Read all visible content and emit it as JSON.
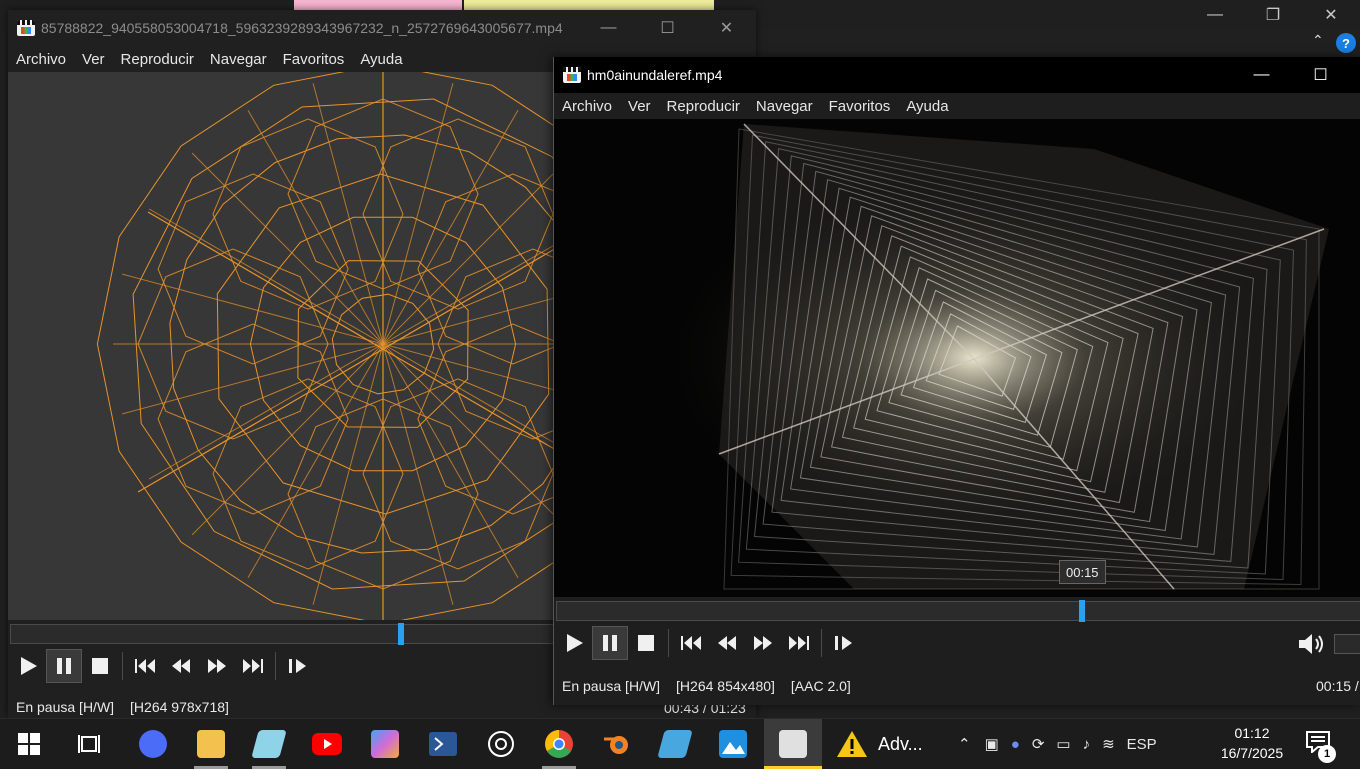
{
  "background_app": {
    "window_controls": [
      "—",
      "❐",
      "✕"
    ],
    "help_glyph": "?",
    "collapse_glyph": "⌃"
  },
  "player1": {
    "title": "85788822_940558053004718_5963239289343967232_n_2572769643005677.mp4",
    "window_controls": {
      "minimize": "—",
      "maximize": "☐",
      "close": "✕"
    },
    "menu": [
      "Archivo",
      "Ver",
      "Reproducir",
      "Navegar",
      "Favoritos",
      "Ayuda"
    ],
    "video_subject": "orange-wireframe-polyhedra",
    "seek_position": 0.52,
    "status": {
      "state": "En pausa [H/W]",
      "codec": "[H264 978x718]"
    },
    "time": "00:43 / 01:23"
  },
  "player2": {
    "title": "hm0ainundaleref.mp4",
    "window_controls": {
      "minimize": "—",
      "maximize": "☐"
    },
    "menu": [
      "Archivo",
      "Ver",
      "Reproducir",
      "Navegar",
      "Favoritos",
      "Ayuda"
    ],
    "video_subject": "white-wireframe-cube-tunnel",
    "seek_tooltip": "00:15",
    "seek_position": 0.65,
    "status": {
      "state": "En pausa [H/W]",
      "codec": "[H264 854x480]",
      "audio": "[AAC 2.0]"
    },
    "time": "00:15 /",
    "volume_value": "4"
  },
  "taskbar": {
    "adv_label": "Adv...",
    "language": "ESP",
    "clock_time": "01:12",
    "clock_date": "16/7/2025",
    "notification_count": "1",
    "apps": [
      {
        "name": "windows-start",
        "color": "#ffffff"
      },
      {
        "name": "task-view",
        "color": "#ffffff"
      },
      {
        "name": "messenger",
        "color": "#4a6cf7"
      },
      {
        "name": "file-explorer",
        "color": "#f2c14e"
      },
      {
        "name": "notes",
        "color": "#8fd3e8"
      },
      {
        "name": "youtube",
        "color": "#ff0000"
      },
      {
        "name": "copilot",
        "color": "#d06bd8"
      },
      {
        "name": "powershell",
        "color": "#2b5797"
      },
      {
        "name": "chatgpt",
        "color": "#ffffff"
      },
      {
        "name": "chrome",
        "color": "#34a853"
      },
      {
        "name": "blender",
        "color": "#f58220"
      },
      {
        "name": "app-blue",
        "color": "#49a7e0"
      },
      {
        "name": "photos",
        "color": "#1f8fe0"
      },
      {
        "name": "media-player-classic",
        "color": "#e0e0e0"
      }
    ]
  }
}
